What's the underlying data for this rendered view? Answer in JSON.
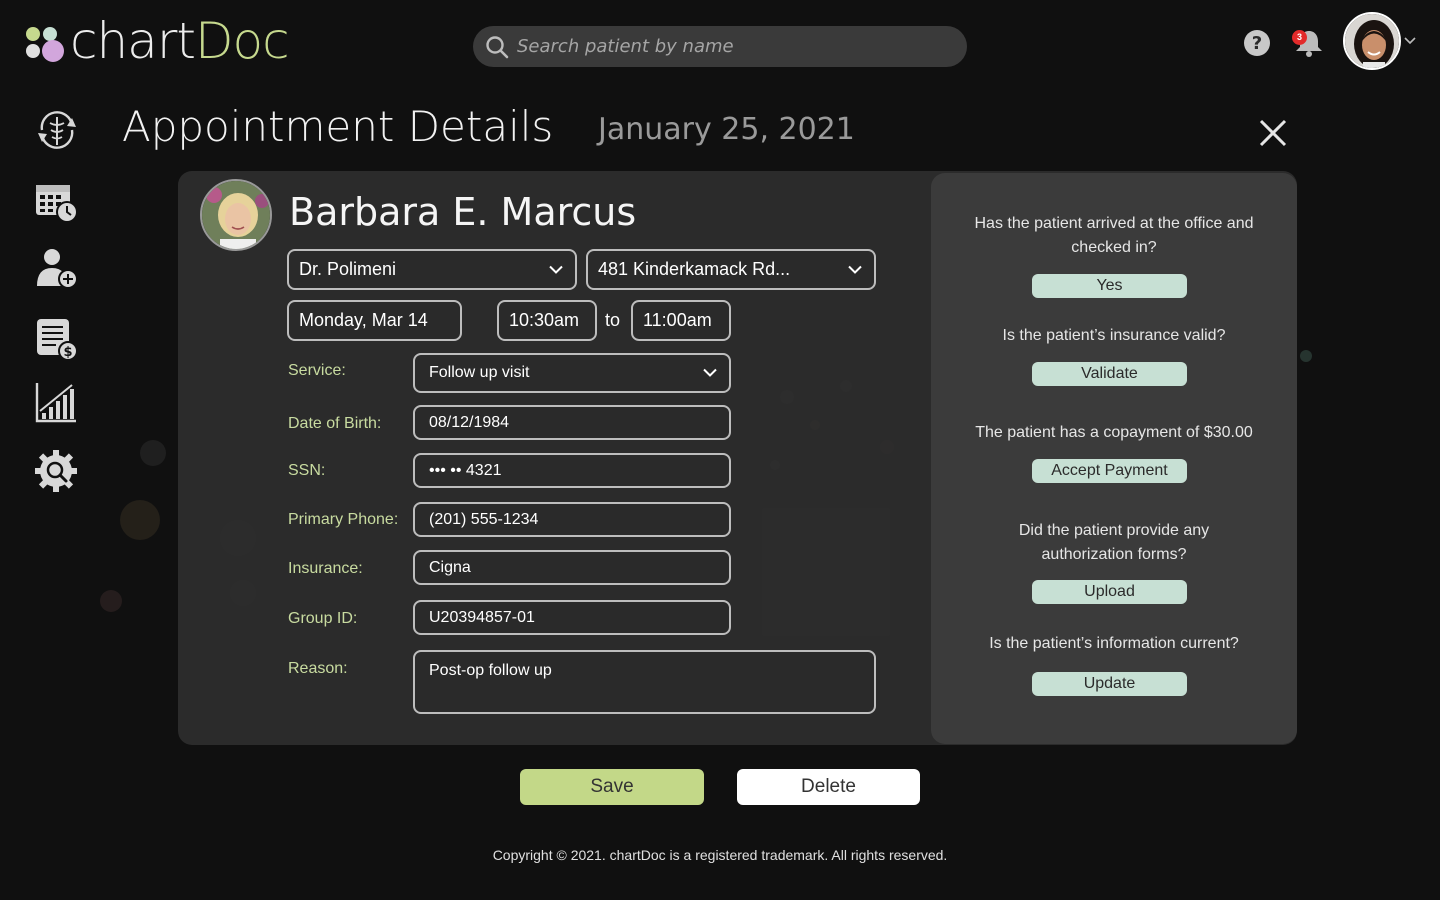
{
  "logo": {
    "part1": "chart",
    "part2": "Doc"
  },
  "search": {
    "placeholder": "Search patient by name"
  },
  "header": {
    "notification_count": "3"
  },
  "sidebar": {
    "items": [
      {
        "name": "caduceus-refresh-icon"
      },
      {
        "name": "calendar-clock-icon"
      },
      {
        "name": "add-user-icon"
      },
      {
        "name": "billing-icon"
      },
      {
        "name": "analytics-chart-icon"
      },
      {
        "name": "settings-search-icon"
      }
    ]
  },
  "page": {
    "title": "Appointment Details",
    "date": "January 25, 2021"
  },
  "patient": {
    "name": "Barbara E. Marcus"
  },
  "appointment": {
    "doctor": "Dr. Polimeni",
    "location": "481 Kinderkamack Rd...",
    "day": "Monday, Mar 14",
    "start_time": "10:30am",
    "to_label": "to",
    "end_time": "11:00am"
  },
  "form": {
    "service_label": "Service:",
    "service_value": "Follow up visit",
    "dob_label": "Date of Birth:",
    "dob_value": "08/12/1984",
    "ssn_label": "SSN:",
    "ssn_value": "••• •• 4321",
    "phone_label": "Primary Phone:",
    "phone_value": "(201) 555-1234",
    "insurance_label": "Insurance:",
    "insurance_value": "Cigna",
    "group_label": "Group ID:",
    "group_value": "U20394857-01",
    "reason_label": "Reason:",
    "reason_value": "Post-op follow up"
  },
  "checklist": [
    {
      "question": "Has the patient arrived at the office and checked in?",
      "action": "Yes"
    },
    {
      "question": "Is the patient’s insurance valid?",
      "action": "Validate"
    },
    {
      "question": "The patient has a copayment of $30.00",
      "action": "Accept Payment"
    },
    {
      "question": "Did the patient provide any authorization forms?",
      "action": "Upload"
    },
    {
      "question": "Is the patient’s information current?",
      "action": "Update"
    }
  ],
  "actions": {
    "save": "Save",
    "delete": "Delete"
  },
  "footer": {
    "copyright": "Copyright © 2021. chartDoc is a registered trademark. All rights reserved."
  },
  "colors": {
    "accent_green": "#c3d888",
    "pill_mint": "#c7e0d4",
    "label_green": "#c8dba0",
    "background": "#101010"
  }
}
